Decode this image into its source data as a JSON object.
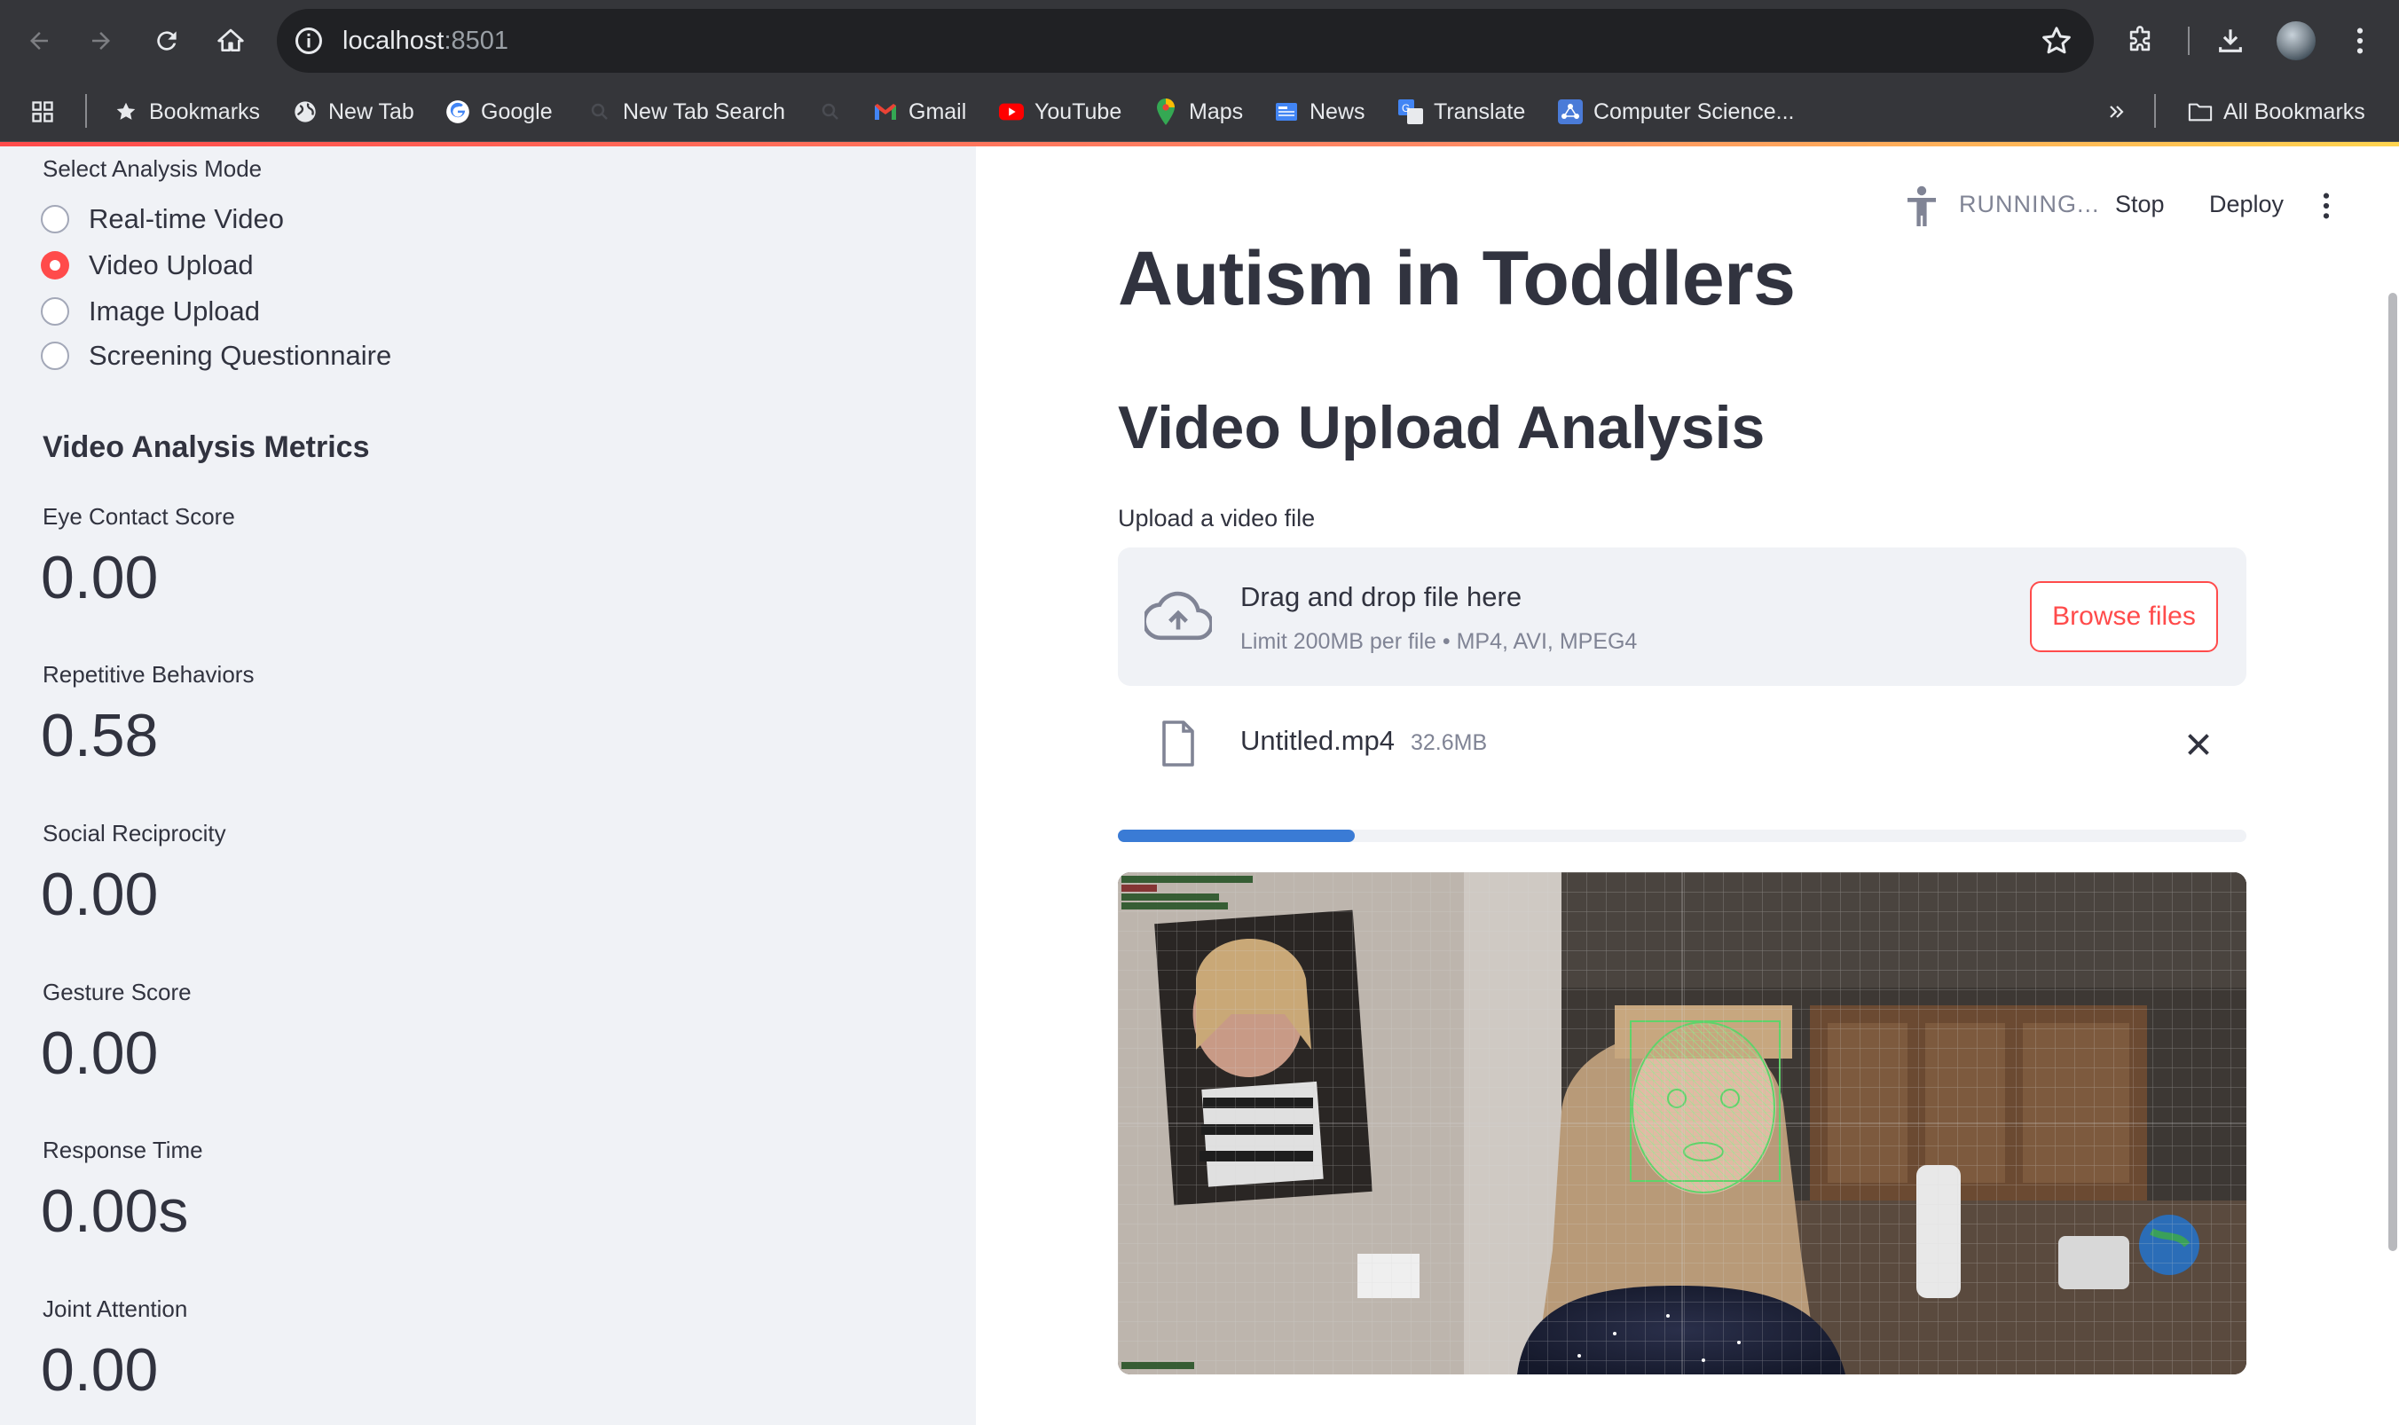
{
  "browser": {
    "url_host": "localhost",
    "url_port": ":8501",
    "bookmarks": [
      {
        "label": "Bookmarks",
        "icon": "star-icon"
      },
      {
        "label": "New Tab",
        "icon": "globe-icon"
      },
      {
        "label": "Google",
        "icon": "google-icon"
      },
      {
        "label": "New Tab Search",
        "icon": "search-icon"
      },
      {
        "label": "",
        "icon": "search-icon"
      },
      {
        "label": "Gmail",
        "icon": "gmail-icon"
      },
      {
        "label": "YouTube",
        "icon": "youtube-icon"
      },
      {
        "label": "Maps",
        "icon": "maps-pin-icon"
      },
      {
        "label": "News",
        "icon": "news-icon"
      },
      {
        "label": "Translate",
        "icon": "translate-icon"
      },
      {
        "label": "Computer Science...",
        "icon": "network-icon"
      }
    ],
    "all_bookmarks": "All Bookmarks"
  },
  "sidebar": {
    "mode_label": "Select Analysis Mode",
    "modes": [
      {
        "label": "Real-time Video",
        "selected": false
      },
      {
        "label": "Video Upload",
        "selected": true
      },
      {
        "label": "Image Upload",
        "selected": false
      },
      {
        "label": "Screening Questionnaire",
        "selected": false
      }
    ],
    "metrics_heading": "Video Analysis Metrics",
    "metrics": [
      {
        "label": "Eye Contact Score",
        "value": "0.00"
      },
      {
        "label": "Repetitive Behaviors",
        "value": "0.58"
      },
      {
        "label": "Social Reciprocity",
        "value": "0.00"
      },
      {
        "label": "Gesture Score",
        "value": "0.00"
      },
      {
        "label": "Response Time",
        "value": "0.00s"
      },
      {
        "label": "Joint Attention",
        "value": "0.00"
      }
    ]
  },
  "header": {
    "status": "RUNNING...",
    "stop": "Stop",
    "deploy": "Deploy"
  },
  "main": {
    "title": "Autism in Toddlers",
    "subtitle": "Video Upload Analysis",
    "upload_label": "Upload a video file",
    "dropzone_text": "Drag and drop file here",
    "dropzone_limit": "Limit 200MB per file • MP4, AVI, MPEG4",
    "browse_label": "Browse files",
    "file_name": "Untitled.mp4",
    "file_size": "32.6MB",
    "progress": 0.21
  },
  "colors": {
    "accent": "#ff4b4b",
    "progress": "#3a7bd5",
    "sidebar_bg": "#f0f2f6",
    "text": "#31333f",
    "face_mesh": "#5fd36a"
  }
}
